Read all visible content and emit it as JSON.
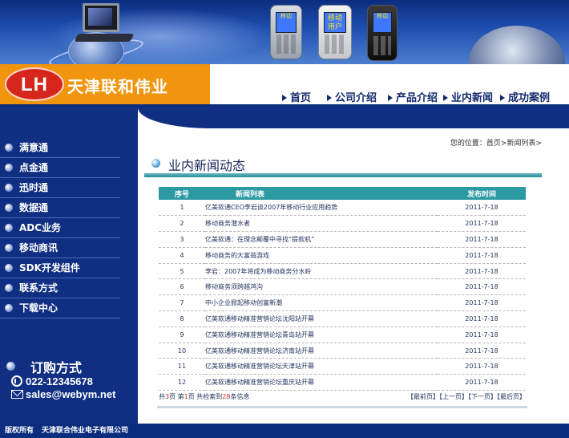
{
  "company": {
    "name": "天津联和伟业",
    "logo_text": "LH"
  },
  "banner": {
    "phone2_screen": "移动用户",
    "phone1_screen": "移动",
    "phone3_screen": "移动"
  },
  "nav": [
    {
      "label": "首页"
    },
    {
      "label": "公司介绍"
    },
    {
      "label": "产品介绍"
    },
    {
      "label": "业内新闻"
    },
    {
      "label": "成功案例"
    }
  ],
  "sidebar": {
    "items": [
      {
        "label": "满意通"
      },
      {
        "label": "点金通"
      },
      {
        "label": "迅时通"
      },
      {
        "label": "数据通"
      },
      {
        "label": "ADC业务"
      },
      {
        "label": "移动商讯"
      },
      {
        "label": "SDK开发组件"
      },
      {
        "label": "联系方式"
      },
      {
        "label": "下载中心"
      }
    ],
    "order": {
      "title": "订购方式",
      "phone": "022-12345678",
      "email": "sales@webym.net"
    }
  },
  "breadcrumb": "您的位置：首页>新闻列表>",
  "section_title": "业内新闻动态",
  "table": {
    "headers": {
      "num": "序号",
      "title": "新闻列表",
      "date": "发布时间"
    },
    "rows": [
      {
        "num": "1",
        "title": "亿美软通CEO李岩谈2007年移动行业应用趋势",
        "date": "2011-7-18"
      },
      {
        "num": "2",
        "title": "移动商务潜水者",
        "date": "2011-7-18"
      },
      {
        "num": "3",
        "title": "亿美软通：在理念颠覆中寻找“提款机”",
        "date": "2011-7-18"
      },
      {
        "num": "4",
        "title": "移动商务的大富翁游戏",
        "date": "2011-7-18"
      },
      {
        "num": "5",
        "title": "李岩：2007年将成为移动商务分水岭",
        "date": "2011-7-18"
      },
      {
        "num": "6",
        "title": "移动商务须跨越鸿沟",
        "date": "2011-7-18"
      },
      {
        "num": "7",
        "title": "中小企业掀起移动创富新潮",
        "date": "2011-7-18"
      },
      {
        "num": "8",
        "title": "亿美软通移动精准营销论坛沈阳站开幕",
        "date": "2011-7-18"
      },
      {
        "num": "9",
        "title": "亿美软通移动精准营销论坛青岛站开幕",
        "date": "2011-7-18"
      },
      {
        "num": "10",
        "title": "亿美软通移动精准营销论坛济南站开幕",
        "date": "2011-7-18"
      },
      {
        "num": "11",
        "title": "亿美软通移动精准营销论坛天津站开幕",
        "date": "2011-7-18"
      },
      {
        "num": "12",
        "title": "亿美软通移动精准营销论坛重庆站开幕",
        "date": "2011-7-18"
      }
    ]
  },
  "pager": {
    "total_pages_prefix": "共",
    "total_pages": "3",
    "total_pages_suffix": "页",
    "current_prefix": "第",
    "current_page": "1",
    "current_suffix": "页",
    "records_prefix": "共检索到",
    "records": "28",
    "records_suffix": "条信息",
    "first": "【最前页】",
    "prev": "【上一页】",
    "next": "【下一页】",
    "last": "【最后页】"
  },
  "footer": {
    "copyright": "版权所有",
    "company": "天津联合伟业电子有限公司"
  },
  "colors": {
    "navy": "#0b2d7e",
    "orange": "#f1950f",
    "teal": "#2c9aa3",
    "red": "#d6261c"
  }
}
